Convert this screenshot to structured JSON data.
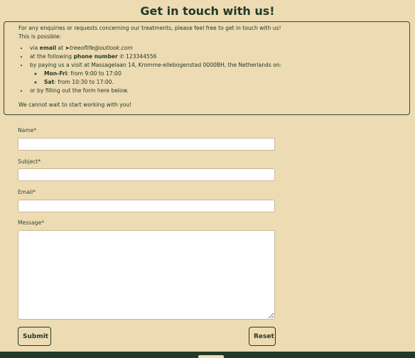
{
  "page": {
    "title": "Get in touch with us!"
  },
  "info": {
    "intro": "For any enquiries or requests concerning our treatments, please feel free to get in touch with us!",
    "possible": "This is possible:",
    "email": {
      "prefix": "via ",
      "bold": "email",
      "at": " at ",
      "address": "treeoflife@outlook.com"
    },
    "phone": {
      "prefix": "at the following ",
      "bold": "phone number",
      "number": "123344556"
    },
    "visit": "by paying us a visit at Massagelaan 14, Kromme-ellebogenstad 0000BH, the Netherlands on:",
    "hours": [
      {
        "day": "Mon-Fri",
        "time": ": from 9:00 to 17:00"
      },
      {
        "day": "Sat",
        "time": ": from 10:30 to 17:00."
      }
    ],
    "form_note": "or by filling out the form here below.",
    "closing": "We cannot wait to start working with you!"
  },
  "form": {
    "name_label": "Name*",
    "subject_label": "Subject*",
    "email_label": "Email*",
    "message_label": "Message*",
    "name_value": "",
    "subject_value": "",
    "email_value": "",
    "message_value": "",
    "submit_label": "Submit",
    "reset_label": "Reset"
  },
  "icons": {
    "email": "paper-plane-icon",
    "phone": "phone-icon"
  },
  "colors": {
    "background": "#eddbb3",
    "primary": "#213a28",
    "input": "#ffffff"
  }
}
